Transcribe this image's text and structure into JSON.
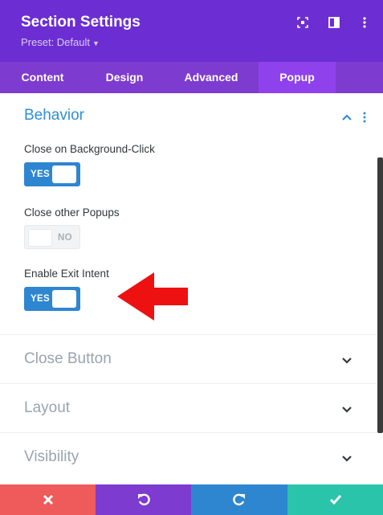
{
  "header": {
    "title": "Section Settings",
    "preset_label": "Preset: Default",
    "icons": [
      "expand-icon",
      "split-view-icon",
      "more-options-icon"
    ]
  },
  "tabs": [
    {
      "label": "Content",
      "active": false
    },
    {
      "label": "Design",
      "active": false
    },
    {
      "label": "Advanced",
      "active": false
    },
    {
      "label": "Popup",
      "active": true
    }
  ],
  "behavior": {
    "title": "Behavior",
    "expanded": true,
    "fields": [
      {
        "label": "Close on Background-Click",
        "value": "YES",
        "on": true
      },
      {
        "label": "Close other Popups",
        "value": "NO",
        "on": false
      },
      {
        "label": "Enable Exit Intent",
        "value": "YES",
        "on": true
      }
    ]
  },
  "collapsed_groups": [
    {
      "title": "Close Button"
    },
    {
      "title": "Layout"
    },
    {
      "title": "Visibility"
    }
  ],
  "footer": {
    "buttons": [
      "close",
      "undo",
      "redo",
      "save"
    ]
  },
  "colors": {
    "header": "#6c2ed2",
    "tabs": "#7e3bd0",
    "active_tab": "#8f42ec",
    "accent": "#2e86d1",
    "annotation_arrow": "#ee1111",
    "footer_close": "#ef5a5a",
    "footer_undo": "#7e3bd0",
    "footer_redo": "#2e86d1",
    "footer_save": "#29c4a9"
  }
}
